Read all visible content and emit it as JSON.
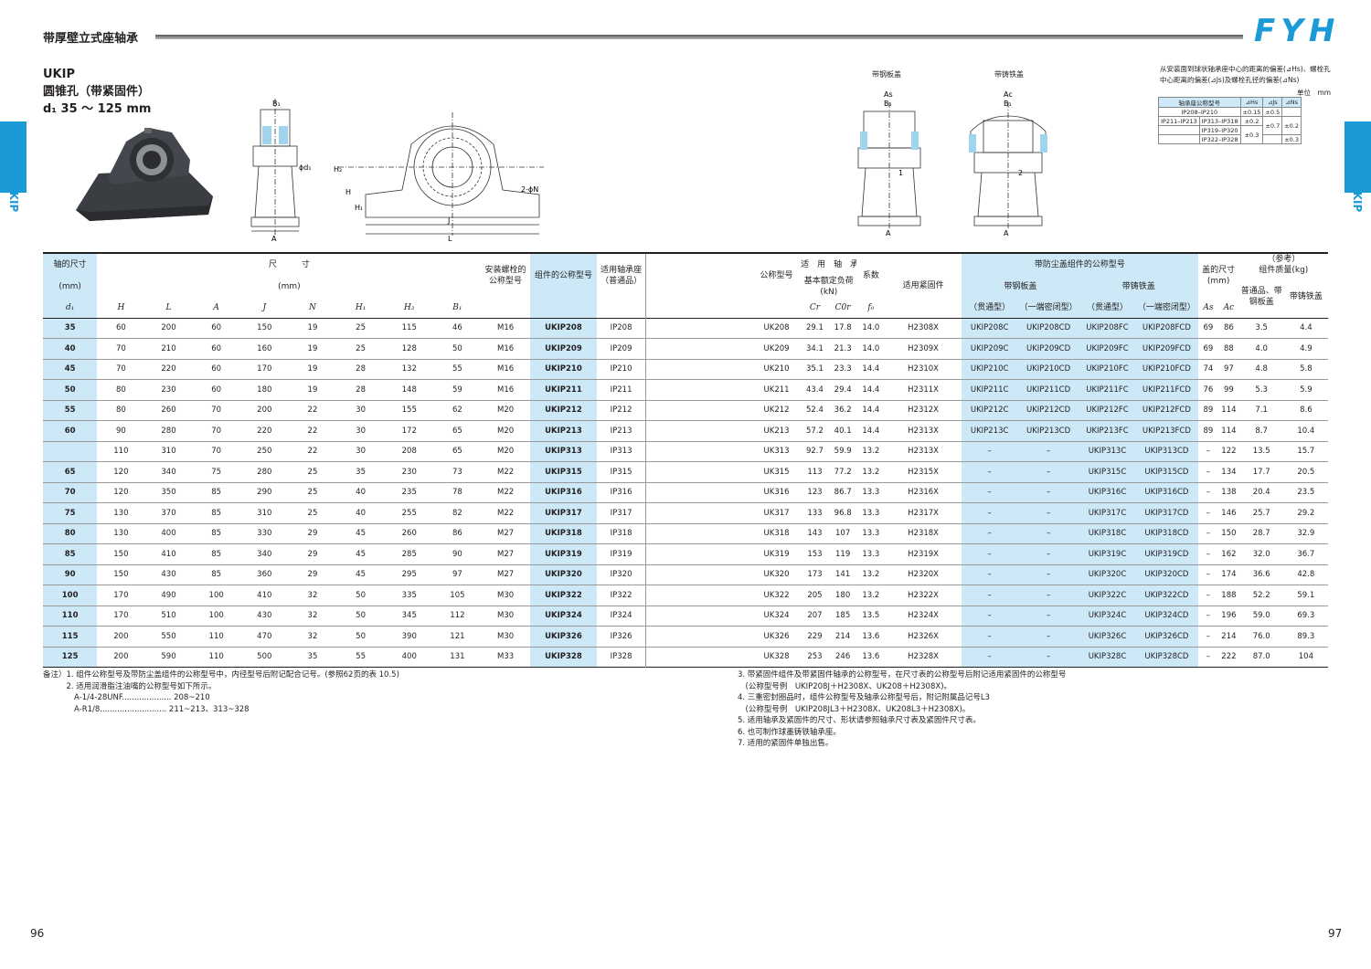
{
  "header": {
    "title": "带厚壁立式座轴承",
    "logo": "FYH",
    "accent": "#1a9ad7"
  },
  "side": {
    "label": "UKIP"
  },
  "product": {
    "code": "UKIP",
    "name": "圆锥孔（带紧固件）",
    "range": "d₁ 35 ～ 125 mm"
  },
  "diagram_labels": {
    "steel_cover": "带钢板盖",
    "cast_cover": "带铸铁盖",
    "B1": "B₁",
    "A": "A",
    "J": "J",
    "L": "L",
    "H": "H",
    "H1": "H₁",
    "H2": "H₂",
    "phi_d1": "ϕd₁",
    "bolt": "2-ϕN",
    "As": "As",
    "Ac": "Ac",
    "n1": "1",
    "n2": "2"
  },
  "tolerance": {
    "note": "从安装面到球状轴承座中心的距离的偏差(⊿Hs)、螺栓孔中心距离的偏差(⊿Js)及螺栓孔径的偏差(⊿Ns)",
    "unit": "单位　mm",
    "headers": [
      "轴承座公称型号",
      "⊿Hs",
      "⊿Js",
      "⊿Ns"
    ],
    "rows": [
      [
        "IP208–IP210",
        "",
        "±0.15",
        "±0.5",
        ""
      ],
      [
        "IP211–IP213",
        "IP313–IP318",
        "±0.2",
        "",
        "±0.2"
      ],
      [
        "",
        "IP319–IP320",
        "±0.3",
        "±0.7",
        ""
      ],
      [
        "",
        "IP322–IP328",
        "",
        "",
        "±0.3"
      ]
    ]
  },
  "table": {
    "h": {
      "d1_title": "轴的尺寸",
      "d1_unit": "(mm)",
      "dims_title": "尺　　　寸",
      "dims_unit": "(mm)",
      "bolt": "安装螺栓的公称型号",
      "unit_no": "组件的公称型号",
      "housing": "适用轴承座（普通品）",
      "bearing": "公称型号",
      "load_title": "适　用　轴　承",
      "load_sub": "基本额定负荷",
      "load_unit": "(kN)",
      "f0_title": "系数",
      "sleeve": "适用紧固件",
      "cover_title": "带防尘盖组件的公称型号",
      "steel": "带钢板盖",
      "cast": "带铸铁盖",
      "thru": "（贯通型）",
      "closed": "（一端密闭型）",
      "coverdim": "盖的尺寸",
      "coverunit": "(mm)",
      "mass_ref": "（参考）",
      "mass": "组件质量(kg)",
      "mass_std": "普通品、带钢板盖",
      "mass_cast": "带铸铁盖",
      "sym": [
        "d₁",
        "H",
        "L",
        "A",
        "J",
        "N",
        "H₁",
        "H₂",
        "B₁",
        "Cr",
        "C0r",
        "f₀",
        "As",
        "Ac"
      ]
    },
    "rows": [
      [
        "35",
        "60",
        "200",
        "60",
        "150",
        "19",
        "25",
        "115",
        "46",
        "M16",
        "UKIP208",
        "IP208",
        "UK208",
        "29.1",
        "17.8",
        "14.0",
        "H2308X",
        "UKIP208C",
        "UKIP208CD",
        "UKIP208FC",
        "UKIP208FCD",
        "69",
        "86",
        "3.5",
        "4.4"
      ],
      [
        "40",
        "70",
        "210",
        "60",
        "160",
        "19",
        "25",
        "128",
        "50",
        "M16",
        "UKIP209",
        "IP209",
        "UK209",
        "34.1",
        "21.3",
        "14.0",
        "H2309X",
        "UKIP209C",
        "UKIP209CD",
        "UKIP209FC",
        "UKIP209FCD",
        "69",
        "88",
        "4.0",
        "4.9"
      ],
      [
        "45",
        "70",
        "220",
        "60",
        "170",
        "19",
        "28",
        "132",
        "55",
        "M16",
        "UKIP210",
        "IP210",
        "UK210",
        "35.1",
        "23.3",
        "14.4",
        "H2310X",
        "UKIP210C",
        "UKIP210CD",
        "UKIP210FC",
        "UKIP210FCD",
        "74",
        "97",
        "4.8",
        "5.8"
      ],
      [
        "50",
        "80",
        "230",
        "60",
        "180",
        "19",
        "28",
        "148",
        "59",
        "M16",
        "UKIP211",
        "IP211",
        "UK211",
        "43.4",
        "29.4",
        "14.4",
        "H2311X",
        "UKIP211C",
        "UKIP211CD",
        "UKIP211FC",
        "UKIP211FCD",
        "76",
        "99",
        "5.3",
        "5.9"
      ],
      [
        "55",
        "80",
        "260",
        "70",
        "200",
        "22",
        "30",
        "155",
        "62",
        "M20",
        "UKIP212",
        "IP212",
        "UK212",
        "52.4",
        "36.2",
        "14.4",
        "H2312X",
        "UKIP212C",
        "UKIP212CD",
        "UKIP212FC",
        "UKIP212FCD",
        "89",
        "114",
        "7.1",
        "8.6"
      ],
      [
        "60",
        "90",
        "280",
        "70",
        "220",
        "22",
        "30",
        "172",
        "65",
        "M20",
        "UKIP213",
        "IP213",
        "UK213",
        "57.2",
        "40.1",
        "14.4",
        "H2313X",
        "UKIP213C",
        "UKIP213CD",
        "UKIP213FC",
        "UKIP213FCD",
        "89",
        "114",
        "8.7",
        "10.4"
      ],
      [
        "",
        "110",
        "310",
        "70",
        "250",
        "22",
        "30",
        "208",
        "65",
        "M20",
        "UKIP313",
        "IP313",
        "UK313",
        "92.7",
        "59.9",
        "13.2",
        "H2313X",
        "–",
        "–",
        "UKIP313C",
        "UKIP313CD",
        "–",
        "122",
        "13.5",
        "15.7"
      ],
      [
        "65",
        "120",
        "340",
        "75",
        "280",
        "25",
        "35",
        "230",
        "73",
        "M22",
        "UKIP315",
        "IP315",
        "UK315",
        "113",
        "77.2",
        "13.2",
        "H2315X",
        "–",
        "–",
        "UKIP315C",
        "UKIP315CD",
        "–",
        "134",
        "17.7",
        "20.5"
      ],
      [
        "70",
        "120",
        "350",
        "85",
        "290",
        "25",
        "40",
        "235",
        "78",
        "M22",
        "UKIP316",
        "IP316",
        "UK316",
        "123",
        "86.7",
        "13.3",
        "H2316X",
        "–",
        "–",
        "UKIP316C",
        "UKIP316CD",
        "–",
        "138",
        "20.4",
        "23.5"
      ],
      [
        "75",
        "130",
        "370",
        "85",
        "310",
        "25",
        "40",
        "255",
        "82",
        "M22",
        "UKIP317",
        "IP317",
        "UK317",
        "133",
        "96.8",
        "13.3",
        "H2317X",
        "–",
        "–",
        "UKIP317C",
        "UKIP317CD",
        "–",
        "146",
        "25.7",
        "29.2"
      ],
      [
        "80",
        "130",
        "400",
        "85",
        "330",
        "29",
        "45",
        "260",
        "86",
        "M27",
        "UKIP318",
        "IP318",
        "UK318",
        "143",
        "107",
        "13.3",
        "H2318X",
        "–",
        "–",
        "UKIP318C",
        "UKIP318CD",
        "–",
        "150",
        "28.7",
        "32.9"
      ],
      [
        "85",
        "150",
        "410",
        "85",
        "340",
        "29",
        "45",
        "285",
        "90",
        "M27",
        "UKIP319",
        "IP319",
        "UK319",
        "153",
        "119",
        "13.3",
        "H2319X",
        "–",
        "–",
        "UKIP319C",
        "UKIP319CD",
        "–",
        "162",
        "32.0",
        "36.7"
      ],
      [
        "90",
        "150",
        "430",
        "85",
        "360",
        "29",
        "45",
        "295",
        "97",
        "M27",
        "UKIP320",
        "IP320",
        "UK320",
        "173",
        "141",
        "13.2",
        "H2320X",
        "–",
        "–",
        "UKIP320C",
        "UKIP320CD",
        "–",
        "174",
        "36.6",
        "42.8"
      ],
      [
        "100",
        "170",
        "490",
        "100",
        "410",
        "32",
        "50",
        "335",
        "105",
        "M30",
        "UKIP322",
        "IP322",
        "UK322",
        "205",
        "180",
        "13.2",
        "H2322X",
        "–",
        "–",
        "UKIP322C",
        "UKIP322CD",
        "–",
        "188",
        "52.2",
        "59.1"
      ],
      [
        "110",
        "170",
        "510",
        "100",
        "430",
        "32",
        "50",
        "345",
        "112",
        "M30",
        "UKIP324",
        "IP324",
        "UK324",
        "207",
        "185",
        "13.5",
        "H2324X",
        "–",
        "–",
        "UKIP324C",
        "UKIP324CD",
        "–",
        "196",
        "59.0",
        "69.3"
      ],
      [
        "115",
        "200",
        "550",
        "110",
        "470",
        "32",
        "50",
        "390",
        "121",
        "M30",
        "UKIP326",
        "IP326",
        "UK326",
        "229",
        "214",
        "13.6",
        "H2326X",
        "–",
        "–",
        "UKIP326C",
        "UKIP326CD",
        "–",
        "214",
        "76.0",
        "89.3"
      ],
      [
        "125",
        "200",
        "590",
        "110",
        "500",
        "35",
        "55",
        "400",
        "131",
        "M33",
        "UKIP328",
        "IP328",
        "UK328",
        "253",
        "246",
        "13.6",
        "H2328X",
        "–",
        "–",
        "UKIP328C",
        "UKIP328CD",
        "–",
        "222",
        "87.0",
        "104"
      ]
    ]
  },
  "notes_left": [
    "备注）1. 组件公称型号及带防尘盖组件的公称型号中，内径型号后附记配合记号。(参照62页的表 10.5)",
    "　　　2. 适用润滑脂注油嘴的公称型号如下所示。",
    "　　　　A-1/4-28UNF.................... 208~210",
    "　　　　A-R1/8........................... 211~213、313~328"
  ],
  "notes_right": [
    "3. 带紧固件组件及带紧固件轴承的公称型号，在尺寸表的公称型号后附记适用紧固件的公称型号",
    "　(公称型号例　UKIP208J＋H2308X、UK208＋H2308X)。",
    "4. 三重密封圈品时，组件公称型号及轴承公称型号后，附记附属品记号L3",
    "　(公称型号例　UKIP208JL3＋H2308X、UK208L3＋H2308X)。",
    "5. 适用轴承及紧固件的尺寸、形状请参照轴承尺寸表及紧固件尺寸表。",
    "6. 也可制作球墨铸铁轴承座。",
    "7. 适用的紧固件单独出售。"
  ],
  "pages": {
    "left": "96",
    "right": "97"
  }
}
